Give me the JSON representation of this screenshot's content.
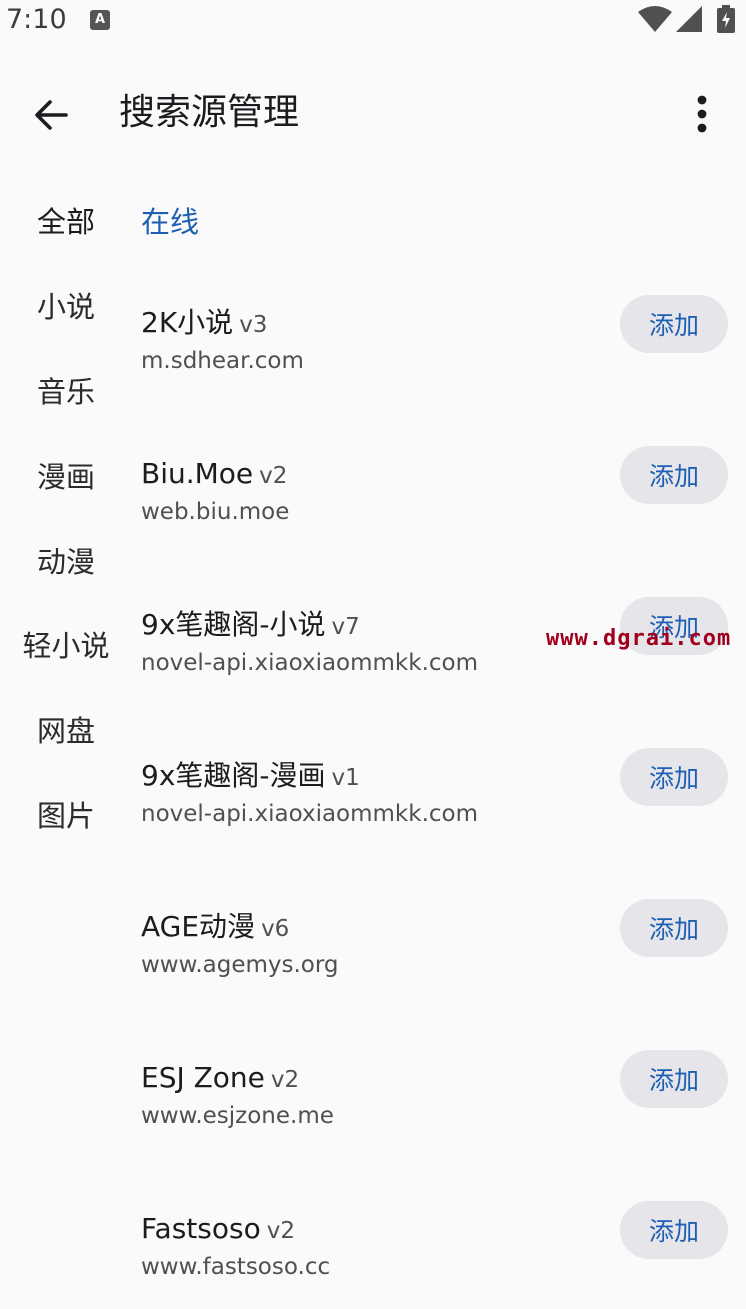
{
  "status_bar": {
    "time": "7:10",
    "notification_letter": "A"
  },
  "app_bar": {
    "title": "搜索源管理"
  },
  "categories": [
    "全部",
    "小说",
    "音乐",
    "漫画",
    "动漫",
    "轻小说",
    "网盘",
    "图片"
  ],
  "section_label": "在线",
  "sources": [
    {
      "name": "2K小说",
      "version": "v3",
      "url": "m.sdhear.com",
      "action": "添加"
    },
    {
      "name": "Biu.Moe",
      "version": "v2",
      "url": "web.biu.moe",
      "action": "添加"
    },
    {
      "name": "9x笔趣阁-小说",
      "version": "v7",
      "url": "novel-api.xiaoxiaommkk.com",
      "action": "添加"
    },
    {
      "name": "9x笔趣阁-漫画",
      "version": "v1",
      "url": "novel-api.xiaoxiaommkk.com",
      "action": "添加"
    },
    {
      "name": "AGE动漫",
      "version": "v6",
      "url": "www.agemys.org",
      "action": "添加"
    },
    {
      "name": "ESJ Zone",
      "version": "v2",
      "url": "www.esjzone.me",
      "action": "添加"
    },
    {
      "name": "Fastsoso",
      "version": "v2",
      "url": "www.fastsoso.cc",
      "action": "添加"
    }
  ],
  "watermark": "www.dgrai.com",
  "colors": {
    "accent": "#1e5fb4",
    "button_bg": "#e6e6ea",
    "background": "#fafafa",
    "watermark": "#a0001e"
  }
}
